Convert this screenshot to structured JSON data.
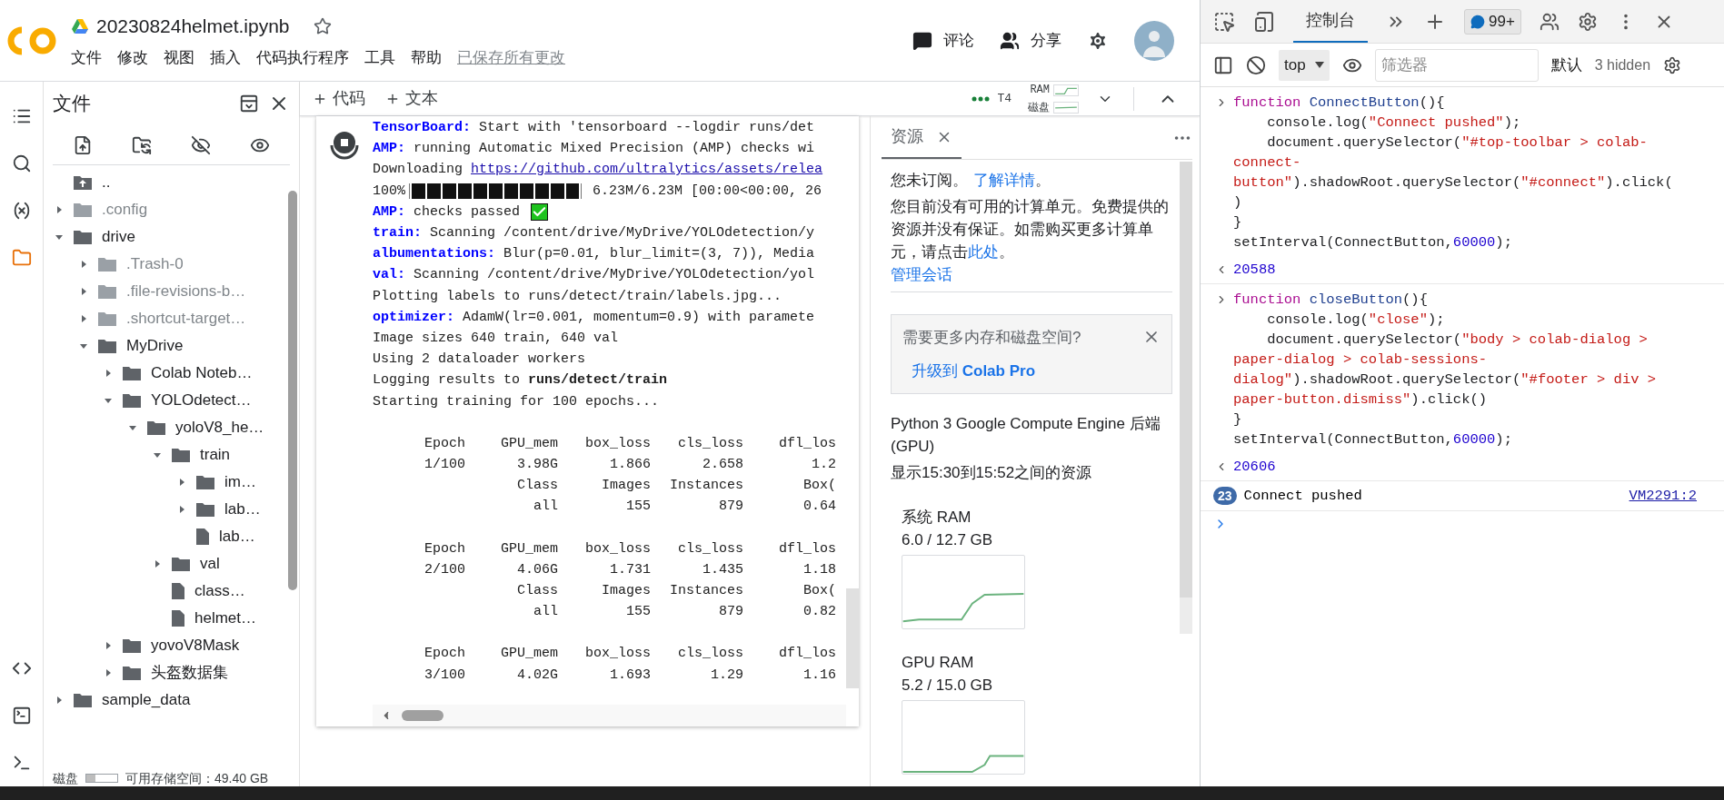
{
  "header": {
    "title": "20230824helmet.ipynb",
    "starred": false,
    "menu": [
      "文件",
      "修改",
      "视图",
      "插入",
      "代码执行程序",
      "工具",
      "帮助"
    ],
    "saved_status": "已保存所有更改",
    "actions": [
      {
        "kind": "comment",
        "label": "评论"
      },
      {
        "kind": "share",
        "label": "分享"
      }
    ]
  },
  "rail": [
    {
      "selected": false
    },
    {
      "selected": false
    },
    {
      "selected": false
    },
    {
      "selected": true
    },
    {
      "selected": false
    },
    {
      "selected": false
    },
    {
      "selected": false
    }
  ],
  "sidebar": {
    "title": "文件",
    "tree": [
      {
        "name": "..",
        "kind": "parent",
        "dimmed": false
      },
      {
        "name": ".config",
        "kind": "folder",
        "expanded": false,
        "dimmed": true
      },
      {
        "name": "drive",
        "kind": "folder",
        "expanded": true,
        "dimmed": false,
        "children": [
          {
            "name": ".Trash-0",
            "kind": "folder",
            "expanded": false,
            "dimmed": true
          },
          {
            "name": ".file-revisions-b…",
            "kind": "folder",
            "expanded": false,
            "dimmed": true
          },
          {
            "name": ".shortcut-target…",
            "kind": "folder",
            "expanded": false,
            "dimmed": true
          },
          {
            "name": "MyDrive",
            "kind": "folder",
            "expanded": true,
            "dimmed": false,
            "children": [
              {
                "name": "Colab Noteb…",
                "kind": "folder",
                "expanded": false,
                "dimmed": false
              },
              {
                "name": "YOLOdetect…",
                "kind": "folder",
                "expanded": true,
                "dimmed": false,
                "children": [
                  {
                    "name": "yoloV8_he…",
                    "kind": "folder",
                    "expanded": true,
                    "dimmed": false,
                    "children": [
                      {
                        "name": "train",
                        "kind": "folder",
                        "expanded": true,
                        "dimmed": false,
                        "children": [
                          {
                            "name": "im…",
                            "kind": "folder",
                            "expanded": false,
                            "dimmed": false
                          },
                          {
                            "name": "lab…",
                            "kind": "folder",
                            "expanded": false,
                            "dimmed": false
                          },
                          {
                            "name": "lab…",
                            "kind": "file",
                            "dimmed": false
                          }
                        ]
                      },
                      {
                        "name": "val",
                        "kind": "folder",
                        "expanded": false,
                        "dimmed": false
                      },
                      {
                        "name": "class…",
                        "kind": "file",
                        "dimmed": false
                      },
                      {
                        "name": "helmet…",
                        "kind": "file",
                        "dimmed": false
                      }
                    ]
                  }
                ]
              },
              {
                "name": "yovoV8Mask",
                "kind": "folder",
                "expanded": false,
                "dimmed": false
              },
              {
                "name": "头盔数据集",
                "kind": "folder",
                "expanded": false,
                "dimmed": false
              }
            ]
          }
        ]
      },
      {
        "name": "sample_data",
        "kind": "folder",
        "expanded": false,
        "dimmed": false
      }
    ],
    "disk": {
      "label": "磁盘",
      "level": 0.3,
      "reading": "可用存储空间：49.40 GB"
    }
  },
  "toolbar": {
    "add_buttons": [
      "代码",
      "文本"
    ],
    "runtime": {
      "gpu": "T4",
      "ram_label": "RAM",
      "disk_label": "磁盘"
    }
  },
  "output": [
    {
      "kind": "text",
      "prefix": "TensorBoard:",
      "text": "Start with 'tensorboard --logdir runs/det"
    },
    {
      "kind": "text",
      "prefix": "AMP:",
      "text": "running Automatic Mixed Precision (AMP) checks wi"
    },
    {
      "kind": "link",
      "text": "Downloading",
      "link": "https://github.com/ultralytics/assets/relea"
    },
    {
      "kind": "progress",
      "text": "100%",
      "level": 1,
      "reading": "6.23M/6.23M [00:00<00:00, 26"
    },
    {
      "kind": "check",
      "prefix": "AMP:",
      "text": "checks passed"
    },
    {
      "kind": "text",
      "prefix": "train:",
      "text": "Scanning /content/drive/MyDrive/YOLOdetection/y"
    },
    {
      "kind": "text",
      "prefix": "albumentations:",
      "text": "Blur(p=0.01, blur_limit=(3, 7)), Media"
    },
    {
      "kind": "text",
      "prefix": "val:",
      "text": "Scanning /content/drive/MyDrive/YOLOdetection/yol"
    },
    {
      "kind": "text",
      "text": "Plotting labels to runs/detect/train/labels.jpg..."
    },
    {
      "kind": "text",
      "prefix": "optimizer:",
      "text": "AdamW(lr=0.001, momentum=0.9) with paramete"
    },
    {
      "kind": "text",
      "text": "Image sizes 640 train, 640 val"
    },
    {
      "kind": "text",
      "text": "Using 2 dataloader workers"
    },
    {
      "kind": "text",
      "text": "Logging results to **runs/detect/train**"
    },
    {
      "kind": "text",
      "text": "Starting training for 100 epochs..."
    },
    {
      "kind": "table",
      "rows": [
        [
          "Epoch",
          "GPU_mem",
          "box_loss",
          "cls_loss",
          "dfl_los"
        ],
        [
          "1/100",
          "3.98G",
          "1.866",
          "2.658",
          "1.2"
        ],
        [
          "Class",
          "Images",
          "Instances",
          "Box("
        ],
        [
          "all",
          "155",
          "879",
          "0.64"
        ]
      ]
    },
    {
      "kind": "table",
      "rows": [
        [
          "Epoch",
          "GPU_mem",
          "box_loss",
          "cls_loss",
          "dfl_los"
        ],
        [
          "2/100",
          "4.06G",
          "1.731",
          "1.435",
          "1.18"
        ],
        [
          "Class",
          "Images",
          "Instances",
          "Box("
        ],
        [
          "all",
          "155",
          "879",
          "0.82"
        ]
      ]
    },
    {
      "kind": "table",
      "rows": [
        [
          "Epoch",
          "GPU_mem",
          "box_loss",
          "cls_loss",
          "dfl_los"
        ],
        [
          "3/100",
          "4.02G",
          "1.693",
          "1.29",
          "1.16"
        ]
      ]
    }
  ],
  "resources": {
    "tab": "资源",
    "subscription": {
      "text": "您未订阅。",
      "link": "了解详情",
      "end": "。"
    },
    "notice": {
      "text": "您目前没有可用的计算单元。免费提供的资源并没有保证。如需购买更多计算单元，请点击",
      "link": "此处",
      "end": "。"
    },
    "manage_link": "管理会话",
    "upgrade_card": {
      "text": "需要更多内存和磁盘空间?",
      "link": "升级到 **Colab Pro**"
    },
    "backend": "Python 3 Google Compute Engine 后端 (GPU)",
    "range": "显示15:30到15:52之间的资源",
    "meters": [
      {
        "title": "系统 RAM",
        "reading": "6.0 / 12.7 GB"
      },
      {
        "title": "GPU RAM",
        "reading": "5.2 / 15.0 GB"
      }
    ]
  },
  "devtools": {
    "tabs": [
      {
        "label": "控制台",
        "selected": true
      }
    ],
    "badge": "99+",
    "context": "top",
    "filter_placeholder": "筛选器",
    "levels": "默认",
    "hidden": "3 hidden",
    "console": [
      {
        "kind": "input",
        "lines": [
          [
            {
              "t": "function ",
              "kind": "kw"
            },
            {
              "t": "ConnectButton",
              "kind": "fn"
            },
            {
              "t": "(){",
              "kind": "p"
            }
          ],
          [
            {
              "t": "    console.log(",
              "kind": "p"
            },
            {
              "t": "\"Connect pushed\"",
              "kind": "str"
            },
            {
              "t": ");",
              "kind": "p"
            }
          ],
          [
            {
              "t": "    document.querySelector(",
              "kind": "p"
            },
            {
              "t": "\"#top-toolbar > colab-",
              "kind": "str"
            }
          ],
          [
            {
              "t": "connect-",
              "kind": "str"
            }
          ],
          [
            {
              "t": "button\"",
              "kind": "str"
            },
            {
              "t": ").shadowRoot.querySelector(",
              "kind": "p"
            },
            {
              "t": "\"#connect\"",
              "kind": "str"
            },
            {
              "t": ").click(",
              "kind": "p"
            }
          ],
          [
            {
              "t": ")",
              "kind": "p"
            }
          ],
          [
            {
              "t": "}",
              "kind": "p"
            }
          ],
          [
            {
              "t": "setInterval(ConnectButton,",
              "kind": "p"
            },
            {
              "t": "60000",
              "kind": "num"
            },
            {
              "t": ");",
              "kind": "p"
            }
          ]
        ]
      },
      {
        "kind": "result",
        "text": "20588"
      },
      {
        "kind": "input",
        "lines": [
          [
            {
              "t": "function ",
              "kind": "kw"
            },
            {
              "t": "closeButton",
              "kind": "fn"
            },
            {
              "t": "(){",
              "kind": "p"
            }
          ],
          [
            {
              "t": "    console.log(",
              "kind": "p"
            },
            {
              "t": "\"close\"",
              "kind": "str"
            },
            {
              "t": ");",
              "kind": "p"
            }
          ],
          [
            {
              "t": "    document.querySelector(",
              "kind": "p"
            },
            {
              "t": "\"body > colab-dialog >",
              "kind": "str"
            }
          ],
          [
            {
              "t": "paper-dialog > colab-sessions-",
              "kind": "str"
            }
          ],
          [
            {
              "t": "dialog\"",
              "kind": "str"
            },
            {
              "t": ").shadowRoot.querySelector(",
              "kind": "p"
            },
            {
              "t": "\"#footer > div >",
              "kind": "str"
            }
          ],
          [
            {
              "t": "paper-button.dismiss\"",
              "kind": "str"
            },
            {
              "t": ").click()",
              "kind": "p"
            }
          ],
          [
            {
              "t": "}",
              "kind": "p"
            }
          ],
          [
            {
              "t": "setInterval(ConnectButton,",
              "kind": "p"
            },
            {
              "t": "60000",
              "kind": "num"
            },
            {
              "t": ");",
              "kind": "p"
            }
          ]
        ]
      },
      {
        "kind": "result",
        "text": "20606"
      },
      {
        "kind": "log",
        "count": "23",
        "text": "Connect pushed",
        "source": "VM2291:2"
      },
      {
        "kind": "prompt"
      }
    ]
  }
}
